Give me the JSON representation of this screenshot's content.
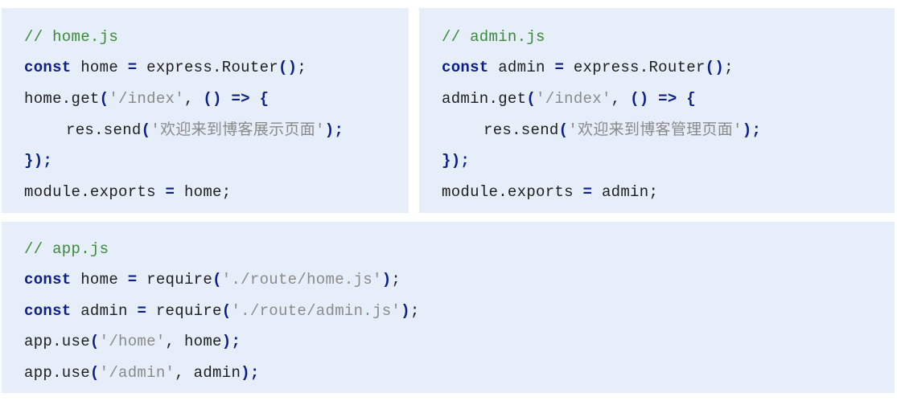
{
  "home_js": {
    "comment": "// home.js",
    "line1": {
      "kw": "const",
      "name": "home",
      "eq": "=",
      "call": "express.Router",
      "parens": "()",
      "semi": ";"
    },
    "line2": {
      "call": "home.get",
      "open": "(",
      "path": "'/index'",
      "comma": ",",
      "arrow": "() => {"
    },
    "line3": {
      "call": "res.send",
      "open": "(",
      "text": "'欢迎来到博客展示页面'",
      "close": ")",
      "semi": ";"
    },
    "line4": {
      "close": "})",
      "semi": ";"
    },
    "line5": {
      "left": "module.exports",
      "eq": "=",
      "right": "home;"
    }
  },
  "admin_js": {
    "comment": "// admin.js",
    "line1": {
      "kw": "const",
      "name": "admin",
      "eq": "=",
      "call": "express.Router",
      "parens": "()",
      "semi": ";"
    },
    "line2": {
      "call": "admin.get",
      "open": "(",
      "path": "'/index'",
      "comma": ",",
      "arrow": "() => {"
    },
    "line3": {
      "call": "res.send",
      "open": "(",
      "text": "'欢迎来到博客管理页面'",
      "close": ")",
      "semi": ";"
    },
    "line4": {
      "close": "})",
      "semi": ";"
    },
    "line5": {
      "left": "module.exports",
      "eq": "=",
      "right": "admin;"
    }
  },
  "app_js": {
    "comment": "// app.js",
    "line1": {
      "kw": "const",
      "name": "home",
      "eq": "=",
      "call": "require",
      "open": "(",
      "path": "'./route/home.js'",
      "close": ")",
      "semi": ";"
    },
    "line2": {
      "kw": "const",
      "name": "admin",
      "eq": "=",
      "call": "require",
      "open": "(",
      "path": "'./route/admin.js'",
      "close": ")",
      "semi": ";"
    },
    "line3": {
      "call": "app.use",
      "open": "(",
      "path": "'/home'",
      "comma": ",",
      "arg": "home",
      "close": ")",
      "semi": ";"
    },
    "line4": {
      "call": "app.use",
      "open": "(",
      "path": "'/admin'",
      "comma": ",",
      "arg": "admin",
      "close": ")",
      "semi": ";"
    }
  }
}
